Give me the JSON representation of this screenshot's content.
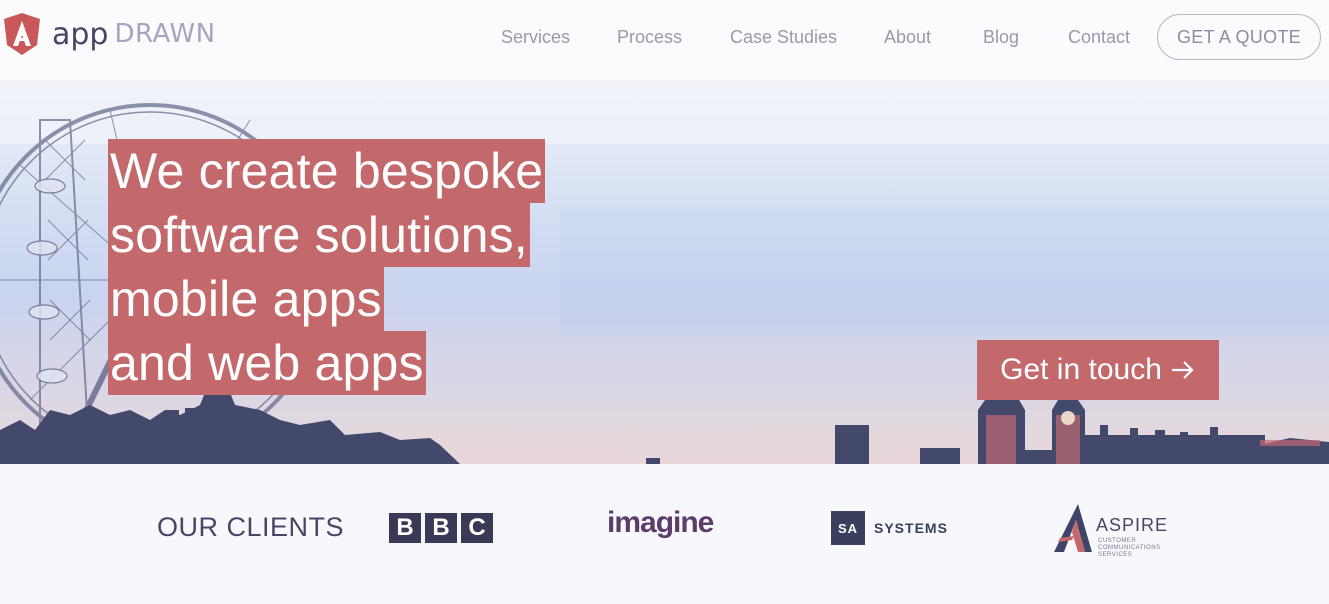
{
  "header": {
    "logo": {
      "app": "app",
      "drawn": "DRAWN",
      "mark": "A"
    },
    "nav": [
      "Services",
      "Process",
      "Case Studies",
      "About",
      "Blog",
      "Contact"
    ],
    "cta": "GET A QUOTE"
  },
  "hero": {
    "headline": [
      "We create bespoke",
      "software solutions,",
      "mobile apps",
      "and web apps"
    ],
    "cta": "Get in touch",
    "cta_icon": "arrow-right-icon"
  },
  "clients": {
    "title": "OUR CLIENTS",
    "logos": {
      "bbc": [
        "B",
        "B",
        "C"
      ],
      "imagine": "imagine",
      "sa_box": "SA",
      "sa_text": "SYSTEMS",
      "aspire_name": "ASPIRE",
      "aspire_sub": "CUSTOMER COMMUNICATIONS SERVICES"
    }
  },
  "colors": {
    "accent": "#c4696b",
    "brand_dark": "#4b4466",
    "nav_text": "#9c98ab"
  }
}
